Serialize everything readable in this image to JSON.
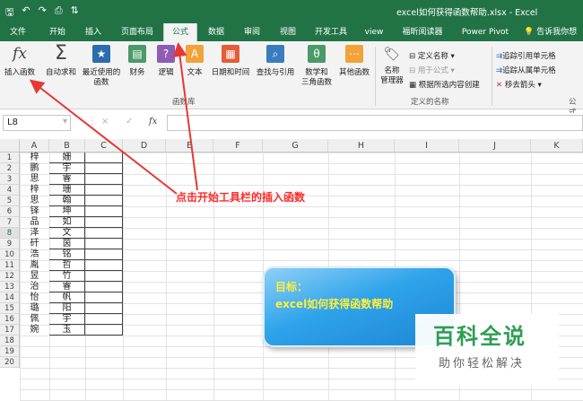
{
  "window": {
    "title": "excel如何获得函数帮助.xlsx - Excel"
  },
  "colors": {
    "brand": "#217346",
    "annotation": "#ff2a2a",
    "goal_text": "#ffef3a",
    "watermark": "#2e9e52"
  },
  "tabs": [
    {
      "label": "文件"
    },
    {
      "label": "开始"
    },
    {
      "label": "插入"
    },
    {
      "label": "页面布局"
    },
    {
      "label": "公式",
      "active": true
    },
    {
      "label": "数据"
    },
    {
      "label": "审阅"
    },
    {
      "label": "视图"
    },
    {
      "label": "开发工具"
    },
    {
      "label": "view"
    },
    {
      "label": "福昕阅读器"
    },
    {
      "label": "Power Pivot"
    },
    {
      "label": "告诉我你想要"
    }
  ],
  "ribbon": {
    "insert_function": "插入函数",
    "autosum": "自动求和",
    "recent_line1": "最近使用的",
    "recent_line2": "函数",
    "financial": "财务",
    "logical": "逻辑",
    "text": "文本",
    "datetime": "日期和时间",
    "lookup": "查找与引用",
    "math_line1": "数学和",
    "math_line2": "三角函数",
    "more": "其他函数",
    "library_label": "函数库",
    "name_manager_line1": "名称",
    "name_manager_line2": "管理器",
    "define_name": "定义名称",
    "use_in_formula": "用于公式",
    "create_from_selection": "根据所选内容创建",
    "defined_names_label": "定义的名称",
    "trace_precedents": "追踪引用单元格",
    "trace_dependents": "追踪从属单元格",
    "remove_arrows": "移去箭头",
    "formula_audit_label": "公式"
  },
  "formula_bar": {
    "name_box": "L8",
    "fx": "fx",
    "cancel": "×",
    "enter": "✓",
    "value": ""
  },
  "columns": [
    "A",
    "B",
    "C",
    "D",
    "E",
    "F",
    "G",
    "H",
    "I",
    "J",
    "K"
  ],
  "rows": [
    "1",
    "2",
    "3",
    "4",
    "5",
    "6",
    "7",
    "8",
    "9",
    "10",
    "11",
    "12",
    "13",
    "14",
    "15",
    "16",
    "17",
    "18",
    "19",
    "20"
  ],
  "selected_row": "8",
  "cells_a": [
    "梓",
    "鹏",
    "思",
    "梓",
    "思",
    "铎",
    "品",
    "泽",
    "矸",
    "浩",
    "胤",
    "昱",
    "治",
    "怡",
    "璐",
    "佩",
    "婉"
  ],
  "cells_b": [
    "姗",
    "宇",
    "睿",
    "珊",
    "翰",
    "坤",
    "如",
    "文",
    "茵",
    "铭",
    "哲",
    "竹",
    "睿",
    "帆",
    "阳",
    "宇",
    "玉"
  ],
  "annotation": {
    "text": "点击开始工具栏的插入函数"
  },
  "goal": {
    "title": "目标：",
    "text": "excel如何获得函数帮助"
  },
  "watermark": {
    "title": "百科全说",
    "subtitle": "助你轻松解决"
  }
}
